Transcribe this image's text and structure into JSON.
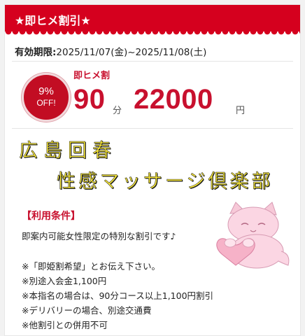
{
  "header": {
    "title": "★即ヒメ割引★"
  },
  "validity": {
    "label": "有効期限:",
    "range": "2025/11/07(金)~2025/11/08(土)"
  },
  "badge": {
    "percent": "9%",
    "off": "OFF!"
  },
  "deal": {
    "name": "即ヒメ割",
    "minutes": "90",
    "minutes_unit": "分",
    "price": "22000",
    "price_unit": "円"
  },
  "banner": {
    "line1": "広島回春",
    "line2": "性感マッサージ倶楽部"
  },
  "conditions": {
    "title": "【利用条件】",
    "lines": [
      "即案内可能女性限定の特別な割引です♪",
      "※「即姫割希望」とお伝え下さい。",
      "※別途入会金1,100円",
      "※本指名の場合は、90分コース以上1,100円割引",
      "※デリバリーの場合、別途交通費",
      "※他割引との併用不可"
    ]
  },
  "colors": {
    "accent": "#d5001e",
    "text_red": "#c8102e",
    "banner_yellow": "#f6e63a"
  }
}
